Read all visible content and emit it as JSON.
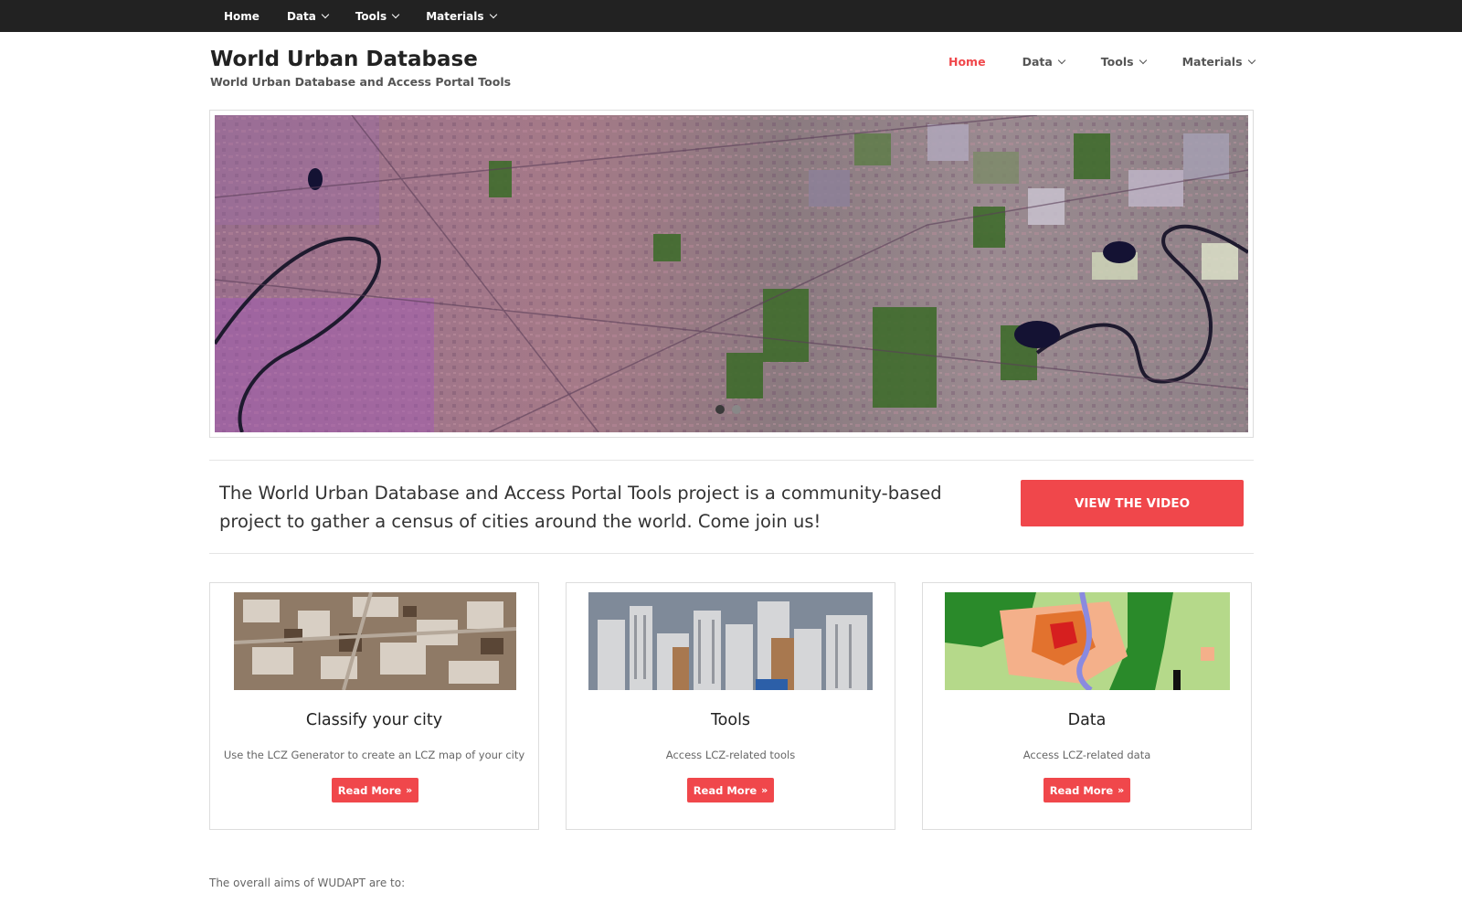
{
  "topbar": {
    "nav": [
      {
        "label": "Home",
        "dropdown": false
      },
      {
        "label": "Data",
        "dropdown": true
      },
      {
        "label": "Tools",
        "dropdown": true
      },
      {
        "label": "Materials",
        "dropdown": true
      }
    ]
  },
  "header": {
    "title": "World Urban Database",
    "description": "World Urban Database and Access Portal Tools",
    "nav": [
      {
        "label": "Home",
        "dropdown": false,
        "active": true
      },
      {
        "label": "Data",
        "dropdown": true,
        "active": false
      },
      {
        "label": "Tools",
        "dropdown": true,
        "active": false
      },
      {
        "label": "Materials",
        "dropdown": true,
        "active": false
      }
    ]
  },
  "slider": {
    "image_icon": "satellite-image",
    "slide_count": 2,
    "active_slide": 1
  },
  "cta": {
    "text": "The World Urban Database and Access Portal Tools project is a community-based project to gather a census of cities around the world. Come join us!",
    "button_label": "VIEW THE VIDEO"
  },
  "cards": [
    {
      "title": "Classify your city",
      "description": "Use the LCZ Generator to create an LCZ map of your city",
      "button_label": "Read More",
      "image_icon": "aerial-city-image"
    },
    {
      "title": "Tools",
      "description": "Access LCZ-related tools",
      "button_label": "Read More",
      "image_icon": "buildings-image"
    },
    {
      "title": "Data",
      "description": "Access LCZ-related data",
      "button_label": "Read More",
      "image_icon": "lcz-map-image"
    }
  ],
  "aims_text": "The overall aims of WUDAPT are to:",
  "colors": {
    "accent": "#f0474b",
    "topbar": "#222222",
    "border": "#dddddd"
  }
}
